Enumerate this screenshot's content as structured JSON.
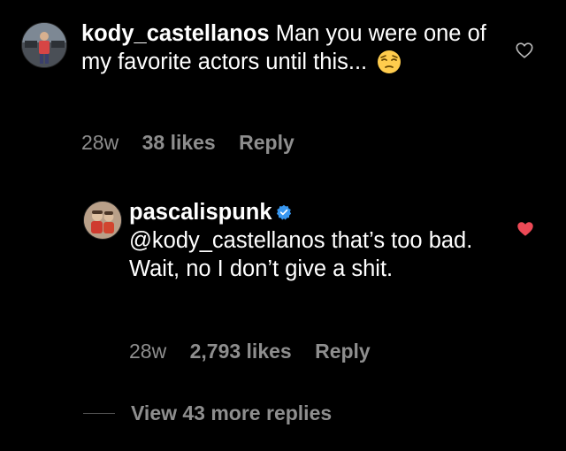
{
  "comments": [
    {
      "username": "kody_castellanos",
      "text": "Man you were one of my favorite actors until this...",
      "emoji": "pensive-face-emoji",
      "age": "28w",
      "likes": "38 likes",
      "reply_label": "Reply",
      "liked": false,
      "verified": false
    },
    {
      "username": "pascalispunk",
      "text": "@kody_castellanos that’s too bad. Wait, no I don’t give a shit.",
      "age": "28w",
      "likes": "2,793 likes",
      "reply_label": "Reply",
      "liked": true,
      "verified": true
    }
  ],
  "view_more": {
    "label": "View 43 more replies"
  },
  "colors": {
    "background": "#000000",
    "text": "#ffffff",
    "meta": "#8e8e8e",
    "heart_liked": "#ed4956",
    "verified": "#3897f0"
  }
}
